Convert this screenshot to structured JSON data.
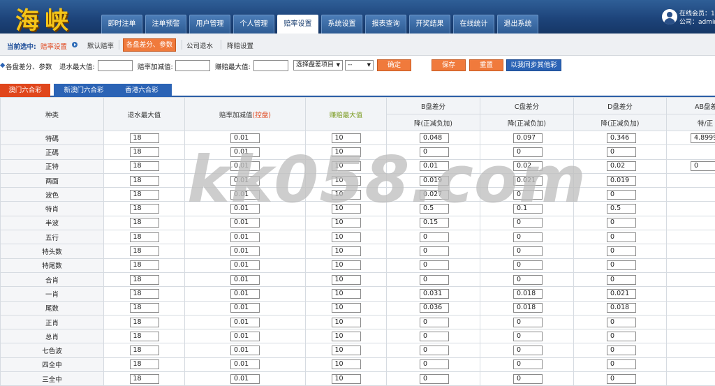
{
  "header": {
    "logo": "海峡",
    "nav": [
      "即时注单",
      "注单预警",
      "用户管理",
      "个人管理",
      "赔率设置",
      "系统设置",
      "报表查询",
      "开奖结果",
      "在线统计",
      "退出系统"
    ],
    "active_nav": 4,
    "user": {
      "online": "在线会员：1",
      "company": "公司：admin"
    }
  },
  "subnav": {
    "current_label": "当前选中:",
    "current_value": "赔率设置",
    "items": [
      "默认赔率",
      "各盘差分、参数",
      "公司退水",
      "降赔设置"
    ],
    "active_item": 1
  },
  "filter": {
    "section_label": "各盘差分、参数",
    "retreat_max_label": "退水最大值:",
    "odds_step_label": "赔率加减值:",
    "win_max_label": "赚赔最大值:",
    "select_item": "选择盘差项目",
    "select_sub": "--",
    "confirm": "确定",
    "save": "保存",
    "reset": "重置",
    "sync": "以我同步其他彩"
  },
  "lottery_tabs": [
    "澳门六合彩",
    "新澳门六合彩",
    "香港六合彩"
  ],
  "active_lottery": 0,
  "table": {
    "head": {
      "kind": "种类",
      "retreat_max": "退水最大值",
      "odds_step": "赔率加减值",
      "odds_step_note": "(控盘)",
      "win_max": "赚赔最大值",
      "b": "B盘差分",
      "c": "C盘差分",
      "d": "D盘差分",
      "ab": "AB盘差",
      "sub_down": "降(正减负加)",
      "sub_ab": "特/正"
    },
    "rows": [
      {
        "name": "特碼",
        "r": "18",
        "o": "0.01",
        "w": "10",
        "b": "0.048",
        "c": "0.097",
        "d": "0.346",
        "ab": "4.8999"
      },
      {
        "name": "正碼",
        "r": "18",
        "o": "0.01",
        "w": "10",
        "b": "0",
        "c": "0",
        "d": "0",
        "ab": ""
      },
      {
        "name": "正特",
        "r": "18",
        "o": "0.01",
        "w": "10",
        "b": "0.01",
        "c": "0.02",
        "d": "0.02",
        "ab": "0"
      },
      {
        "name": "两面",
        "r": "18",
        "o": "0.01",
        "w": "10",
        "b": "0.019",
        "c": "0.021",
        "d": "0.019",
        "ab": ""
      },
      {
        "name": "波色",
        "r": "18",
        "o": "0.01",
        "w": "10",
        "b": "0.027",
        "c": "0",
        "d": "0",
        "ab": ""
      },
      {
        "name": "特肖",
        "r": "18",
        "o": "0.01",
        "w": "10",
        "b": "0.5",
        "c": "0.1",
        "d": "0.5",
        "ab": ""
      },
      {
        "name": "半波",
        "r": "18",
        "o": "0.01",
        "w": "10",
        "b": "0.15",
        "c": "0",
        "d": "0",
        "ab": ""
      },
      {
        "name": "五行",
        "r": "18",
        "o": "0.01",
        "w": "10",
        "b": "0",
        "c": "0",
        "d": "0",
        "ab": ""
      },
      {
        "name": "特头数",
        "r": "18",
        "o": "0.01",
        "w": "10",
        "b": "0",
        "c": "0",
        "d": "0",
        "ab": ""
      },
      {
        "name": "特尾数",
        "r": "18",
        "o": "0.01",
        "w": "10",
        "b": "0",
        "c": "0",
        "d": "0",
        "ab": ""
      },
      {
        "name": "合肖",
        "r": "18",
        "o": "0.01",
        "w": "10",
        "b": "0",
        "c": "0",
        "d": "0",
        "ab": ""
      },
      {
        "name": "一肖",
        "r": "18",
        "o": "0.01",
        "w": "10",
        "b": "0.031",
        "c": "0.018",
        "d": "0.021",
        "ab": ""
      },
      {
        "name": "尾数",
        "r": "18",
        "o": "0.01",
        "w": "10",
        "b": "0.036",
        "c": "0.018",
        "d": "0.018",
        "ab": ""
      },
      {
        "name": "正肖",
        "r": "18",
        "o": "0.01",
        "w": "10",
        "b": "0",
        "c": "0",
        "d": "0",
        "ab": ""
      },
      {
        "name": "总肖",
        "r": "18",
        "o": "0.01",
        "w": "10",
        "b": "0",
        "c": "0",
        "d": "0",
        "ab": ""
      },
      {
        "name": "七色波",
        "r": "18",
        "o": "0.01",
        "w": "10",
        "b": "0",
        "c": "0",
        "d": "0",
        "ab": ""
      },
      {
        "name": "四全中",
        "r": "18",
        "o": "0.01",
        "w": "10",
        "b": "0",
        "c": "0",
        "d": "0",
        "ab": ""
      },
      {
        "name": "三全中",
        "r": "18",
        "o": "0.01",
        "w": "10",
        "b": "0",
        "c": "0",
        "d": "0",
        "ab": ""
      }
    ]
  },
  "watermark": "kk058.com",
  "colors": {
    "header": "#1c4278",
    "accent": "#f07a3c",
    "tab_blue": "#2b63b5",
    "tab_active": "#e0461c"
  }
}
